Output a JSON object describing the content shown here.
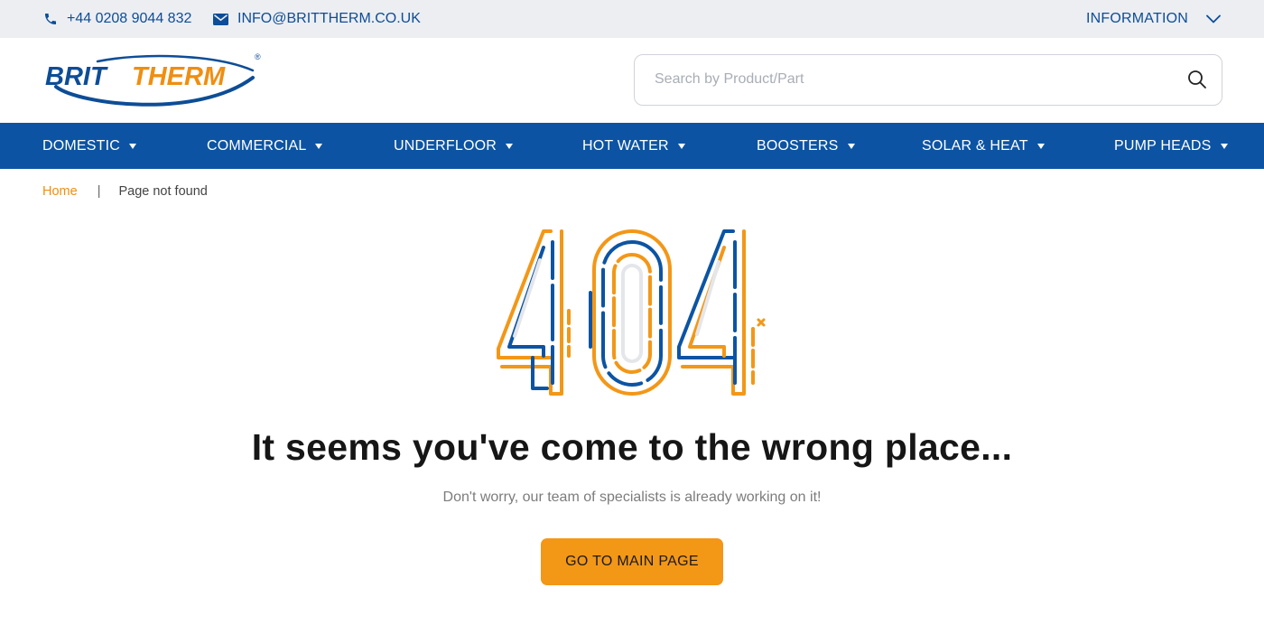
{
  "topbar": {
    "phone": "+44 0208 9044 832",
    "email": "INFO@BRITTHERM.CO.UK",
    "information": "INFORMATION",
    "icons": {
      "phone": "phone-icon",
      "email": "envelope-icon",
      "information": "chevron-down-icon"
    }
  },
  "header": {
    "logo": {
      "text_blue": "BRIT",
      "text_orange": "THERM",
      "registered": "®"
    },
    "search": {
      "placeholder": "Search by Product/Part",
      "value": "",
      "icon": "search-icon"
    }
  },
  "nav": {
    "items": [
      {
        "label": "DOMESTIC"
      },
      {
        "label": "COMMERCIAL"
      },
      {
        "label": "UNDERFLOOR"
      },
      {
        "label": "HOT WATER"
      },
      {
        "label": "BOOSTERS"
      },
      {
        "label": "SOLAR & HEAT"
      },
      {
        "label": "PUMP HEADS"
      }
    ]
  },
  "breadcrumb": {
    "home": "Home",
    "separator": "|",
    "current": "Page not found"
  },
  "error": {
    "code": "404",
    "headline": "It seems you've come to the wrong place...",
    "subline": "Don't worry, our team of specialists is already working on it!",
    "button": "GO TO MAIN PAGE"
  },
  "colors": {
    "brand_blue": "#0c54a3",
    "brand_orange": "#f39717",
    "topbar_bg": "#eceef2",
    "breadcrumb_link": "#ef8e12"
  }
}
